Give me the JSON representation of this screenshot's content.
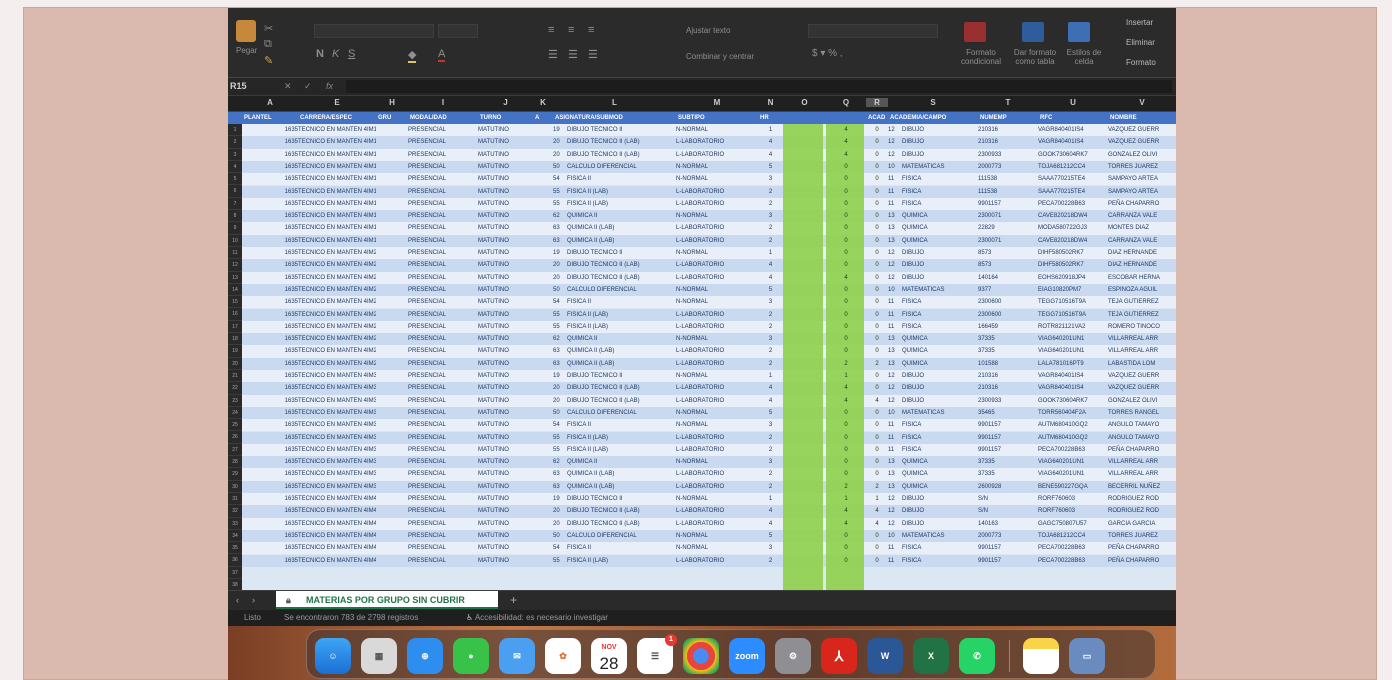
{
  "ribbon": {
    "paste_label": "Pegar",
    "wrap_text": "Ajustar texto",
    "merge_center": "Combinar y centrar",
    "cond_format": "Formato condicional",
    "format_table": "Dar formato como tabla",
    "cell_styles": "Estilos de celda",
    "insert": "Insertar",
    "delete": "Eliminar",
    "format": "Formato"
  },
  "formula_bar": {
    "name_box": "R15",
    "fx": "fx"
  },
  "columns": [
    "A",
    "E",
    "H",
    "I",
    "J",
    "K",
    "L",
    "M",
    "N",
    "O",
    "Q",
    "R",
    "S",
    "T",
    "U",
    "V"
  ],
  "header_row": [
    "PLANTEL",
    "CARRERA/ESPEC",
    "GRU",
    "MODALIDAD",
    "TURNO",
    "A",
    "ASIGNATURA/SUBMOD",
    "SUBTIPO",
    "HR",
    "",
    "",
    "ACAD",
    "ACADEMIA/CAMPO",
    "NUMEMP",
    "RFC",
    "NOMBRE"
  ],
  "row_numbers": [
    "1",
    "2",
    "3",
    "4",
    "5",
    "6",
    "7",
    "8",
    "9",
    "10",
    "11",
    "12",
    "13",
    "14",
    "15",
    "16",
    "17",
    "18",
    "19",
    "20",
    "21",
    "22",
    "23",
    "24",
    "25",
    "26",
    "27",
    "28",
    "29",
    "30",
    "31",
    "32",
    "33",
    "34",
    "35",
    "36",
    "37",
    "38"
  ],
  "rows": [
    [
      "1635",
      "TECNICO EN MANTEN 4IM1",
      "PRESENCIAL",
      "MATUTINO",
      "19",
      "DIBUJO TECNICO II",
      "N-NORMAL",
      "1",
      "4",
      "0",
      "12",
      "DIBUJO",
      "210316",
      "VAGR840401IS4",
      "VAZQUEZ GUERR"
    ],
    [
      "1635",
      "TECNICO EN MANTEN 4IM1",
      "PRESENCIAL",
      "MATUTINO",
      "20",
      "DIBUJO TECNICO II (LAB)",
      "L-LABORATORIO",
      "4",
      "4",
      "0",
      "12",
      "DIBUJO",
      "210316",
      "VAGR840401IS4",
      "VAZQUEZ GUERR"
    ],
    [
      "1635",
      "TECNICO EN MANTEN 4IM1",
      "PRESENCIAL",
      "MATUTINO",
      "20",
      "DIBUJO TECNICO II (LAB)",
      "L-LABORATORIO",
      "4",
      "4",
      "0",
      "12",
      "DIBUJO",
      "2300933",
      "GOOK730604RK7",
      "GONZALEZ OLIVI"
    ],
    [
      "1635",
      "TECNICO EN MANTEN 4IM1",
      "PRESENCIAL",
      "MATUTINO",
      "50",
      "CALCULO DIFERENCIAL",
      "N-NORMAL",
      "5",
      "0",
      "0",
      "10",
      "MATEMATICAS",
      "2000773",
      "TOJA681212CC4",
      "TORRES JUAREZ"
    ],
    [
      "1635",
      "TECNICO EN MANTEN 4IM1",
      "PRESENCIAL",
      "MATUTINO",
      "54",
      "FISICA II",
      "N-NORMAL",
      "3",
      "0",
      "0",
      "11",
      "FISICA",
      "111538",
      "SAAA770215TE4",
      "SAMPAYO ARTEA"
    ],
    [
      "1635",
      "TECNICO EN MANTEN 4IM1",
      "PRESENCIAL",
      "MATUTINO",
      "55",
      "FISICA II (LAB)",
      "L-LABORATORIO",
      "2",
      "0",
      "0",
      "11",
      "FISICA",
      "111538",
      "SAAA770215TE4",
      "SAMPAYO ARTEA"
    ],
    [
      "1635",
      "TECNICO EN MANTEN 4IM1",
      "PRESENCIAL",
      "MATUTINO",
      "55",
      "FISICA II (LAB)",
      "L-LABORATORIO",
      "2",
      "0",
      "0",
      "11",
      "FISICA",
      "9901157",
      "PECA700228B63",
      "PEÑA CHAPARRO"
    ],
    [
      "1635",
      "TECNICO EN MANTEN 4IM1",
      "PRESENCIAL",
      "MATUTINO",
      "62",
      "QUIMICA II",
      "N-NORMAL",
      "3",
      "0",
      "0",
      "13",
      "QUIMICA",
      "2300071",
      "CAVE820218DW4",
      "CARRANZA VALE"
    ],
    [
      "1635",
      "TECNICO EN MANTEN 4IM1",
      "PRESENCIAL",
      "MATUTINO",
      "63",
      "QUIMICA II (LAB)",
      "L-LABORATORIO",
      "2",
      "0",
      "0",
      "13",
      "QUIMICA",
      "22829",
      "MODA580722GJ3",
      "MONTES DIAZ"
    ],
    [
      "1635",
      "TECNICO EN MANTEN 4IM1",
      "PRESENCIAL",
      "MATUTINO",
      "63",
      "QUIMICA II (LAB)",
      "L-LABORATORIO",
      "2",
      "0",
      "0",
      "13",
      "QUIMICA",
      "2300071",
      "CAVE820218DW4",
      "CARRANZA VALE"
    ],
    [
      "1635",
      "TECNICO EN MANTEN 4IM2",
      "PRESENCIAL",
      "MATUTINO",
      "19",
      "DIBUJO TECNICO II",
      "N-NORMAL",
      "1",
      "0",
      "0",
      "12",
      "DIBUJO",
      "8573",
      "DIHF580502RK7",
      "DIAZ HERNANDE"
    ],
    [
      "1635",
      "TECNICO EN MANTEN 4IM2",
      "PRESENCIAL",
      "MATUTINO",
      "20",
      "DIBUJO TECNICO II (LAB)",
      "L-LABORATORIO",
      "4",
      "0",
      "0",
      "12",
      "DIBUJO",
      "8573",
      "DIHF580502RK7",
      "DIAZ HERNANDE"
    ],
    [
      "1635",
      "TECNICO EN MANTEN 4IM2",
      "PRESENCIAL",
      "MATUTINO",
      "20",
      "DIBUJO TECNICO II (LAB)",
      "L-LABORATORIO",
      "4",
      "4",
      "0",
      "12",
      "DIBUJO",
      "140164",
      "EOHS620918JP4",
      "ESCOBAR HERNA"
    ],
    [
      "1635",
      "TECNICO EN MANTEN 4IM2",
      "PRESENCIAL",
      "MATUTINO",
      "50",
      "CALCULO DIFERENCIAL",
      "N-NORMAL",
      "5",
      "0",
      "0",
      "10",
      "MATEMATICAS",
      "9377",
      "EIAG10820PM7",
      "ESPINOZA AGUIL"
    ],
    [
      "1635",
      "TECNICO EN MANTEN 4IM2",
      "PRESENCIAL",
      "MATUTINO",
      "54",
      "FISICA II",
      "N-NORMAL",
      "3",
      "0",
      "0",
      "11",
      "FISICA",
      "2300600",
      "TEGG710516T9A",
      "TEJA GUTIERREZ"
    ],
    [
      "1635",
      "TECNICO EN MANTEN 4IM2",
      "PRESENCIAL",
      "MATUTINO",
      "55",
      "FISICA II (LAB)",
      "L-LABORATORIO",
      "2",
      "0",
      "0",
      "11",
      "FISICA",
      "2300600",
      "TEGG710516T9A",
      "TEJA GUTIERREZ"
    ],
    [
      "1635",
      "TECNICO EN MANTEN 4IM2",
      "PRESENCIAL",
      "MATUTINO",
      "55",
      "FISICA II (LAB)",
      "L-LABORATORIO",
      "2",
      "0",
      "0",
      "11",
      "FISICA",
      "166459",
      "ROTR821121VA2",
      "ROMERO TINOCO"
    ],
    [
      "1635",
      "TECNICO EN MANTEN 4IM2",
      "PRESENCIAL",
      "MATUTINO",
      "62",
      "QUIMICA II",
      "N-NORMAL",
      "3",
      "0",
      "0",
      "13",
      "QUIMICA",
      "37335",
      "VIAG640201UN1",
      "VILLARREAL ARR"
    ],
    [
      "1635",
      "TECNICO EN MANTEN 4IM2",
      "PRESENCIAL",
      "MATUTINO",
      "63",
      "QUIMICA II (LAB)",
      "L-LABORATORIO",
      "2",
      "0",
      "0",
      "13",
      "QUIMICA",
      "37335",
      "VIAG640201UN1",
      "VILLARREAL ARR"
    ],
    [
      "1635",
      "TECNICO EN MANTEN 4IM2",
      "PRESENCIAL",
      "MATUTINO",
      "63",
      "QUIMICA II (LAB)",
      "L-LABORATORIO",
      "2",
      "2",
      "2",
      "13",
      "QUIMICA",
      "101588",
      "LALA781016PT9",
      "LABASTIDA LOM"
    ],
    [
      "1635",
      "TECNICO EN MANTEN 4IM3",
      "PRESENCIAL",
      "MATUTINO",
      "19",
      "DIBUJO TECNICO II",
      "N-NORMAL",
      "1",
      "1",
      "0",
      "12",
      "DIBUJO",
      "210316",
      "VAGR840401IS4",
      "VAZQUEZ GUERR"
    ],
    [
      "1635",
      "TECNICO EN MANTEN 4IM3",
      "PRESENCIAL",
      "MATUTINO",
      "20",
      "DIBUJO TECNICO II (LAB)",
      "L-LABORATORIO",
      "4",
      "4",
      "0",
      "12",
      "DIBUJO",
      "210316",
      "VAGR840401IS4",
      "VAZQUEZ GUERR"
    ],
    [
      "1635",
      "TECNICO EN MANTEN 4IM3",
      "PRESENCIAL",
      "MATUTINO",
      "20",
      "DIBUJO TECNICO II (LAB)",
      "L-LABORATORIO",
      "4",
      "4",
      "4",
      "12",
      "DIBUJO",
      "2300933",
      "GOOK730604RK7",
      "GONZALEZ OLIVI"
    ],
    [
      "1635",
      "TECNICO EN MANTEN 4IM3",
      "PRESENCIAL",
      "MATUTINO",
      "50",
      "CALCULO DIFERENCIAL",
      "N-NORMAL",
      "5",
      "0",
      "0",
      "10",
      "MATEMATICAS",
      "35465",
      "TORR560404F2A",
      "TORRES RANGEL"
    ],
    [
      "1635",
      "TECNICO EN MANTEN 4IM3",
      "PRESENCIAL",
      "MATUTINO",
      "54",
      "FISICA II",
      "N-NORMAL",
      "3",
      "0",
      "0",
      "11",
      "FISICA",
      "9901157",
      "AUTM680410GQ2",
      "ANGULO TAMAYO"
    ],
    [
      "1635",
      "TECNICO EN MANTEN 4IM3",
      "PRESENCIAL",
      "MATUTINO",
      "55",
      "FISICA II (LAB)",
      "L-LABORATORIO",
      "2",
      "0",
      "0",
      "11",
      "FISICA",
      "9901157",
      "AUTM680410GQ2",
      "ANGULO TAMAYO"
    ],
    [
      "1635",
      "TECNICO EN MANTEN 4IM3",
      "PRESENCIAL",
      "MATUTINO",
      "55",
      "FISICA II (LAB)",
      "L-LABORATORIO",
      "2",
      "0",
      "0",
      "11",
      "FISICA",
      "9901157",
      "PECA700228B63",
      "PEÑA CHAPARRO"
    ],
    [
      "1635",
      "TECNICO EN MANTEN 4IM3",
      "PRESENCIAL",
      "MATUTINO",
      "62",
      "QUIMICA II",
      "N-NORMAL",
      "3",
      "0",
      "0",
      "13",
      "QUIMICA",
      "37335",
      "VIAG640201UN1",
      "VILLARREAL ARR"
    ],
    [
      "1635",
      "TECNICO EN MANTEN 4IM3",
      "PRESENCIAL",
      "MATUTINO",
      "63",
      "QUIMICA II (LAB)",
      "L-LABORATORIO",
      "2",
      "0",
      "0",
      "13",
      "QUIMICA",
      "37335",
      "VIAG640201UN1",
      "VILLARREAL ARR"
    ],
    [
      "1635",
      "TECNICO EN MANTEN 4IM3",
      "PRESENCIAL",
      "MATUTINO",
      "63",
      "QUIMICA II (LAB)",
      "L-LABORATORIO",
      "2",
      "2",
      "2",
      "13",
      "QUIMICA",
      "2600928",
      "BENE590227GQA",
      "BECERRIL NUÑEZ"
    ],
    [
      "1635",
      "TECNICO EN MANTEN 4IM4",
      "PRESENCIAL",
      "MATUTINO",
      "19",
      "DIBUJO TECNICO II",
      "N-NORMAL",
      "1",
      "1",
      "1",
      "12",
      "DIBUJO",
      "S/N",
      "RORF760603",
      "RODRIGUEZ ROD"
    ],
    [
      "1635",
      "TECNICO EN MANTEN 4IM4",
      "PRESENCIAL",
      "MATUTINO",
      "20",
      "DIBUJO TECNICO II (LAB)",
      "L-LABORATORIO",
      "4",
      "4",
      "4",
      "12",
      "DIBUJO",
      "S/N",
      "RORF760603",
      "RODRIGUEZ ROD"
    ],
    [
      "1635",
      "TECNICO EN MANTEN 4IM4",
      "PRESENCIAL",
      "MATUTINO",
      "20",
      "DIBUJO TECNICO II (LAB)",
      "L-LABORATORIO",
      "4",
      "4",
      "4",
      "12",
      "DIBUJO",
      "140163",
      "GAGC750807U57",
      "GARCIA GARCIA"
    ],
    [
      "1635",
      "TECNICO EN MANTEN 4IM4",
      "PRESENCIAL",
      "MATUTINO",
      "50",
      "CALCULO DIFERENCIAL",
      "N-NORMAL",
      "5",
      "0",
      "0",
      "10",
      "MATEMATICAS",
      "2000773",
      "TOJA681212CC4",
      "TORRES JUAREZ"
    ],
    [
      "1635",
      "TECNICO EN MANTEN 4IM4",
      "PRESENCIAL",
      "MATUTINO",
      "54",
      "FISICA II",
      "N-NORMAL",
      "3",
      "0",
      "0",
      "11",
      "FISICA",
      "9901157",
      "PECA700228B63",
      "PEÑA CHAPARRO"
    ],
    [
      "1635",
      "TECNICO EN MANTEN 4IM4",
      "PRESENCIAL",
      "MATUTINO",
      "55",
      "FISICA II (LAB)",
      "L-LABORATORIO",
      "2",
      "0",
      "0",
      "11",
      "FISICA",
      "9901157",
      "PECA700228B63",
      "PEÑA CHAPARRO"
    ]
  ],
  "sheet_tab": "MATERIAS POR GRUPO SIN CUBRIR",
  "status": {
    "ready": "Listo",
    "found": "Se encontraron 783 de 2798 registros",
    "accessibility": "Accesibilidad: es necesario investigar"
  },
  "dock": {
    "calendar_month": "NOV",
    "calendar_day": "28",
    "reminders_badge": "1",
    "zoom_label": "zoom"
  },
  "colors": {
    "header_blue": "#4472c4",
    "highlight_green": "#8fd14f",
    "excel_green": "#217346"
  }
}
